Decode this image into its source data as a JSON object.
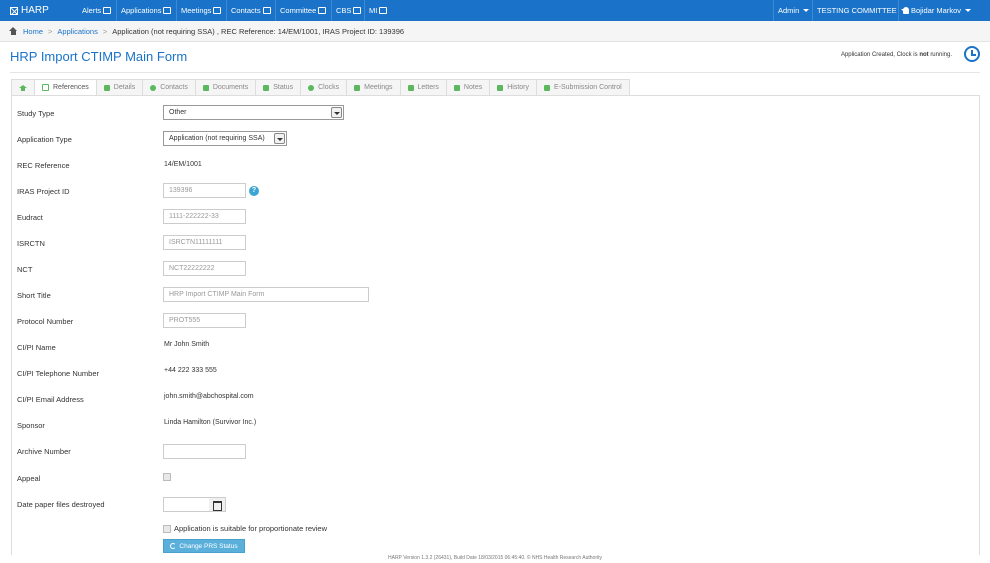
{
  "navbar": {
    "brand": "HARP",
    "items": [
      {
        "label": "Alerts",
        "icon": "monitor-icon"
      },
      {
        "label": "Applications",
        "icon": "edit-icon"
      },
      {
        "label": "Meetings",
        "icon": "calendar-icon"
      },
      {
        "label": "Contacts",
        "icon": "contacts-book-icon"
      },
      {
        "label": "Committee",
        "icon": "group-icon"
      },
      {
        "label": "CBS",
        "icon": "checkbox-icon"
      },
      {
        "label": "MI",
        "icon": "bar-chart-icon"
      }
    ],
    "admin_label": "Admin",
    "committee_label": "TESTING COMMITTEE",
    "user_label": "Bojidar Markov"
  },
  "breadcrumb": {
    "home": "Home",
    "applications": "Applications",
    "current": "Application (not requiring SSA) , REC Reference: 14/EM/1001, IRAS Project ID: 139396"
  },
  "page": {
    "title": "HRP Import CTIMP Main Form",
    "clock_status_prefix": "Application Created, Clock is",
    "clock_status_bold": "not",
    "clock_status_suffix": "running."
  },
  "tabs": [
    {
      "label": "",
      "icon": "home-icon"
    },
    {
      "label": "References",
      "icon": "edit-icon",
      "active": true
    },
    {
      "label": "Details",
      "icon": "book-icon"
    },
    {
      "label": "Contacts",
      "icon": "group-icon"
    },
    {
      "label": "Documents",
      "icon": "paperclip-icon"
    },
    {
      "label": "Status",
      "icon": "gavel-icon"
    },
    {
      "label": "Clocks",
      "icon": "clock-icon"
    },
    {
      "label": "Meetings",
      "icon": "calendar-icon"
    },
    {
      "label": "Letters",
      "icon": "envelope-icon"
    },
    {
      "label": "Notes",
      "icon": "pencil-icon"
    },
    {
      "label": "History",
      "icon": "history-icon"
    },
    {
      "label": "E-Submission Control",
      "icon": "document-icon"
    }
  ],
  "form": {
    "study_type": {
      "label": "Study Type",
      "value": "Other"
    },
    "application_type": {
      "label": "Application Type",
      "value": "Application (not requiring SSA)"
    },
    "rec_reference": {
      "label": "REC Reference",
      "value": "14/EM/1001"
    },
    "iras_project_id": {
      "label": "IRAS Project ID",
      "value": "139396"
    },
    "eudract": {
      "label": "Eudract",
      "value": "1111-222222-33"
    },
    "isrctn": {
      "label": "ISRCTN",
      "value": "ISRCTN11111111"
    },
    "nct": {
      "label": "NCT",
      "value": "NCT22222222"
    },
    "short_title": {
      "label": "Short Title",
      "value": "HRP Import CTIMP Main Form"
    },
    "protocol_number": {
      "label": "Protocol Number",
      "value": "PROT555"
    },
    "ci_pi_name": {
      "label": "CI/PI Name",
      "value": "Mr John Smith"
    },
    "ci_pi_telephone": {
      "label": "CI/PI Telephone Number",
      "value": "+44 222 333 555"
    },
    "ci_pi_email": {
      "label": "CI/PI Email Address",
      "value": "john.smith@abchospital.com"
    },
    "sponsor": {
      "label": "Sponsor",
      "value": "Linda Hamilton (Survivor Inc.)"
    },
    "archive_number": {
      "label": "Archive Number",
      "value": ""
    },
    "appeal": {
      "label": "Appeal"
    },
    "date_paper_destroyed": {
      "label": "Date paper files destroyed",
      "value": ""
    },
    "proportionate_review_label": "Application is suitable for proportionate review",
    "change_prs_button": "Change PRS Status"
  },
  "footer": "HARP Version 1.3.2 (26431), Build Date 18/03/2015 06:45:40. © NHS Health Research Authority"
}
